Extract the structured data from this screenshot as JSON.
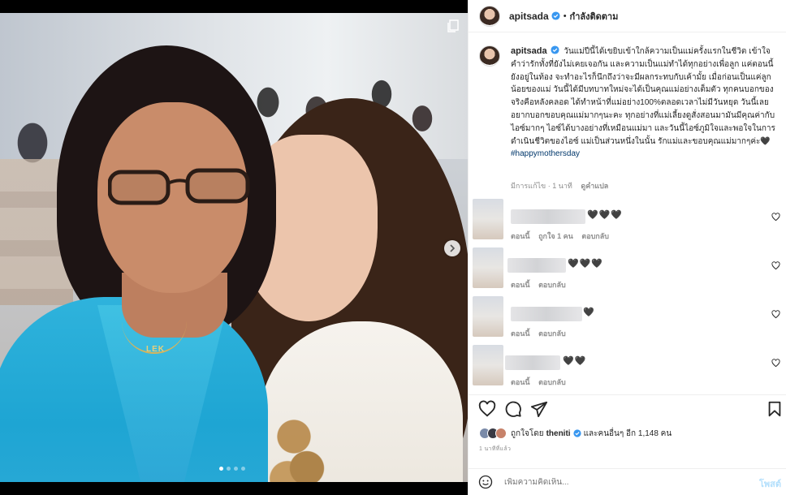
{
  "header": {
    "username": "apitsada",
    "separator": "•",
    "follow_status": "กำลังติดตาม"
  },
  "caption": {
    "username": "apitsada",
    "text": "วันแม่ปีนี้ได้เขยิบเข้าใกล้ความเป็นแม่ครั้งแรกในชีวิต เข้าใจคำว่ารักทั้งที่ยังไม่เคยเจอกัน และความเป็นแม่ทำได้ทุกอย่างเพื่อลูก แค่ตอนนี้ยังอยู่ในท้อง จะทำอะไรก็นึกถึงว่าจะมีผลกระทบกับเค้ามั้ย เมื่อก่อนเป็นแค่ลูกน้อยของแม่ วันนี้ได้มีบทบาทใหม่จะได้เป็นคุณแม่อย่างเต็มตัว ทุกคนบอกของจริงคือหลังคลอด ได้ทำหน้าที่แม่อย่าง100%ตลอดเวลาไม่มีวันหยุด วันนี้เลยอยากบอกขอบคุณแม่มากๆนะคะ ทุกอย่างที่แม่เลี้ยงดูสั่งสอนมามันมีคุณค่ากับไอซ์มากๆ ไอซ์ได้บางอย่างที่เหมือนแม่มา และวันนี้ไอซ์ภูมิใจและพอใจในการดำเนินชีวิตของไอซ์ แม่เป็นส่วนหนึ่งในนั้น รักแม่และขอบคุณแม่มากๆค่ะ🖤",
    "hashtag": "#happymothersday",
    "edited": "มีการแก้ไข · 1 นาที",
    "translate": "ดูคำแปล"
  },
  "comments": [
    {
      "text": "🖤🖤🖤",
      "meta_time": "ตอนนี้",
      "meta_likes": "ถูกใจ 1 คน",
      "meta_reply": "ตอบกลับ"
    },
    {
      "text": "🖤🖤🖤",
      "meta_time": "ตอนนี้",
      "meta_reply": "ตอบกลับ"
    },
    {
      "text": "🖤",
      "meta_time": "ตอนนี้",
      "meta_reply": "ตอบกลับ"
    },
    {
      "text": "🖤🖤",
      "meta_time": "ตอนนี้",
      "meta_reply": "ตอบกลับ"
    }
  ],
  "likes": {
    "prefix": "ถูกใจโดย",
    "user": "theniti",
    "suffix": "และคนอื่นๆ อีก 1,148 คน"
  },
  "timestamp": "1 นาทีที่แล้ว",
  "add_comment": {
    "placeholder": "เพิ่มความคิดเห็น...",
    "post_label": "โพสต์"
  },
  "photo": {
    "necklace_text": "LEK",
    "carousel_total": 4,
    "carousel_active": 1
  },
  "colors": {
    "verified": "#3897f0",
    "link": "#00376b",
    "post_disabled": "#b2dffc",
    "muted": "#8e8e8e"
  }
}
